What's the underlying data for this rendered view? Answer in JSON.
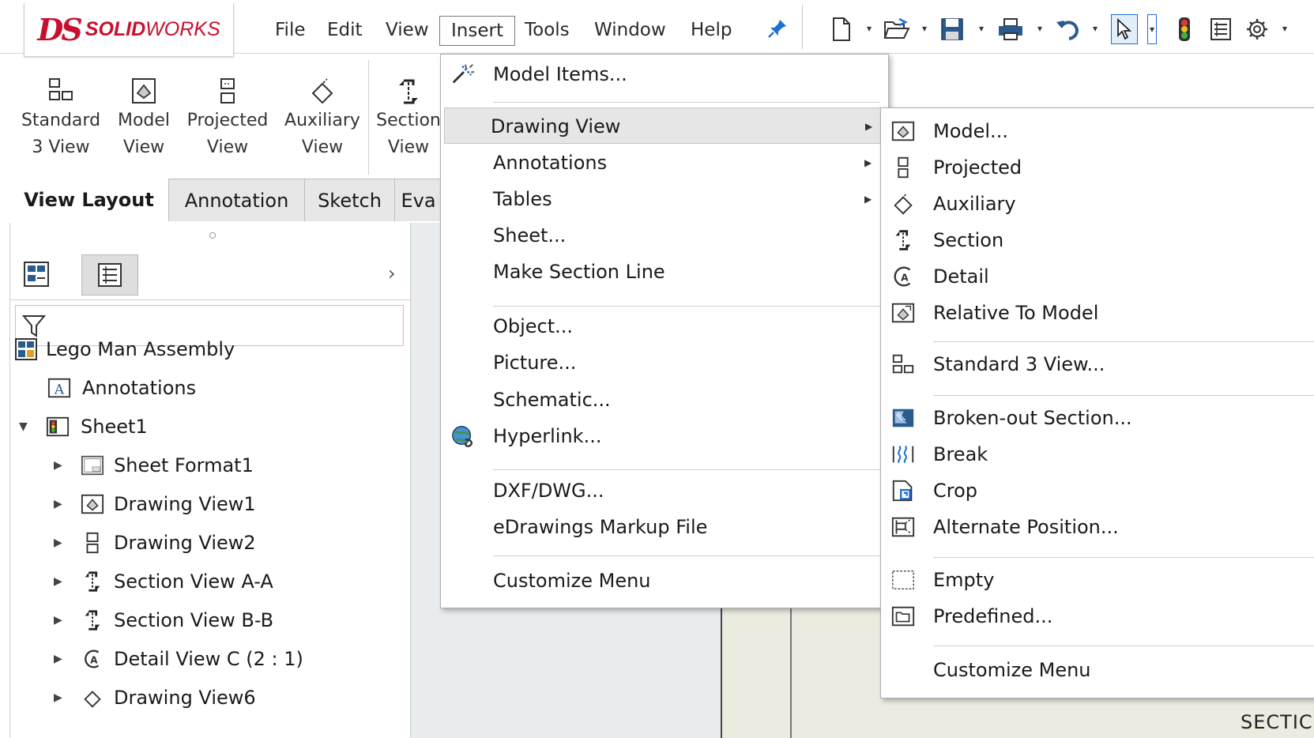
{
  "app": {
    "logo_prefix": "DS",
    "logo_bold": "SOLID",
    "logo_light": "WORKS"
  },
  "menubar": {
    "items": [
      "File",
      "Edit",
      "View",
      "Insert",
      "Tools",
      "Window",
      "Help"
    ],
    "active": "Insert"
  },
  "quick_access": [
    "new-document-icon",
    "open-icon",
    "save-icon",
    "print-icon",
    "undo-icon",
    "select-icon",
    "rebuild-icon",
    "file-properties-icon",
    "options-icon"
  ],
  "command_manager": {
    "buttons": [
      {
        "line1": "Standard",
        "line2": "3 View"
      },
      {
        "line1": "Model",
        "line2": "View"
      },
      {
        "line1": "Projected",
        "line2": "View"
      },
      {
        "line1": "Auxiliary",
        "line2": "View"
      },
      {
        "line1": "Section",
        "line2": "View"
      }
    ],
    "tabs": [
      "View Layout",
      "Annotation",
      "Sketch",
      "Eva"
    ]
  },
  "tree": {
    "root": "Lego Man Assembly",
    "items": [
      {
        "label": "Annotations"
      },
      {
        "label": "Sheet1"
      },
      {
        "label": "Sheet Format1"
      },
      {
        "label": "Drawing View1"
      },
      {
        "label": "Drawing View2"
      },
      {
        "label": "Section View A-A"
      },
      {
        "label": "Section View B-B"
      },
      {
        "label": "Detail View C (2 : 1)"
      },
      {
        "label": "Drawing View6"
      }
    ]
  },
  "insert_menu": {
    "items": [
      {
        "label": "Model Items..."
      },
      {
        "label": "Drawing View"
      },
      {
        "label": "Annotations"
      },
      {
        "label": "Tables"
      },
      {
        "label": "Sheet..."
      },
      {
        "label": "Make Section Line"
      },
      {
        "label": "Object..."
      },
      {
        "label": "Picture..."
      },
      {
        "label": "Schematic..."
      },
      {
        "label": "Hyperlink..."
      },
      {
        "label": "DXF/DWG..."
      },
      {
        "label": "eDrawings Markup File"
      },
      {
        "label": "Customize Menu"
      }
    ]
  },
  "drawing_view_menu": {
    "items": [
      {
        "label": "Model..."
      },
      {
        "label": "Projected"
      },
      {
        "label": "Auxiliary"
      },
      {
        "label": "Section"
      },
      {
        "label": "Detail"
      },
      {
        "label": "Relative To Model"
      },
      {
        "label": "Standard 3 View..."
      },
      {
        "label": "Broken-out Section..."
      },
      {
        "label": "Break"
      },
      {
        "label": "Crop"
      },
      {
        "label": "Alternate Position..."
      },
      {
        "label": "Empty"
      },
      {
        "label": "Predefined..."
      },
      {
        "label": "Customize Menu"
      }
    ]
  },
  "canvas": {
    "sheet_text": "SECTIC"
  },
  "colors": {
    "brand": "#c8102e",
    "accent": "#1f6fd1",
    "menu_hover": "#e6e6e6",
    "sheet": "#ecebe0"
  }
}
